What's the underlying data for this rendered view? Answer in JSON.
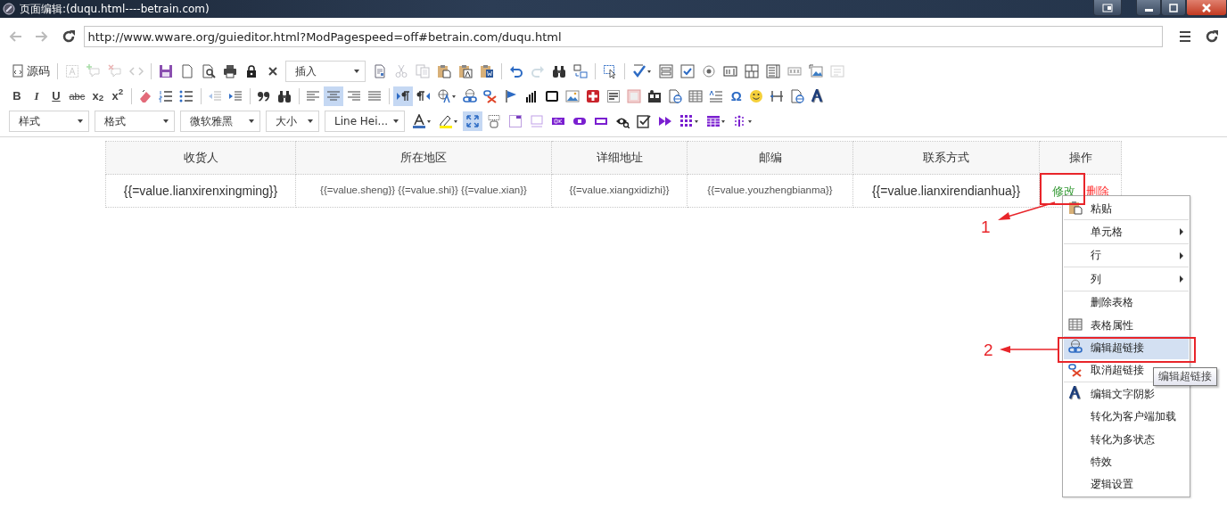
{
  "window": {
    "title": "页面编辑:(duqu.html----betrain.com)"
  },
  "browser": {
    "nav": [
      {
        "kind": "back",
        "disabled": true
      },
      {
        "kind": "forward",
        "disabled": true
      },
      {
        "kind": "reload",
        "disabled": false
      }
    ],
    "url": "http://www.wware.org/guieditor.html?ModPagespeed=off#betrain.com/duqu.html"
  },
  "toolbar_rows": [
    [
      {
        "kind": "text-button",
        "label": "源码"
      },
      {
        "kind": "separator"
      },
      {
        "kind": "icon",
        "disabled": true
      },
      {
        "kind": "icon",
        "disabled": true
      },
      {
        "kind": "icon",
        "disabled": true
      },
      {
        "kind": "icon",
        "disabled": true
      },
      {
        "kind": "separator"
      },
      {
        "kind": "icon",
        "disabled": false
      },
      {
        "kind": "icon",
        "disabled": false
      },
      {
        "kind": "icon",
        "disabled": false
      },
      {
        "kind": "icon",
        "disabled": false
      },
      {
        "kind": "icon",
        "disabled": false
      },
      {
        "kind": "icon",
        "disabled": false
      },
      {
        "kind": "select",
        "value": "插入"
      },
      {
        "kind": "icon",
        "disabled": false
      },
      {
        "kind": "icon",
        "disabled": true
      },
      {
        "kind": "icon",
        "disabled": true
      },
      {
        "kind": "icon",
        "disabled": false
      },
      {
        "kind": "icon",
        "disabled": false
      },
      {
        "kind": "icon",
        "disabled": false
      },
      {
        "kind": "separator"
      },
      {
        "kind": "icon",
        "disabled": false
      },
      {
        "kind": "icon",
        "disabled": true
      },
      {
        "kind": "icon",
        "disabled": false
      },
      {
        "kind": "icon",
        "disabled": false
      },
      {
        "kind": "separator"
      },
      {
        "kind": "icon",
        "disabled": false
      },
      {
        "kind": "separator"
      },
      {
        "kind": "icon",
        "disabled": false
      },
      {
        "kind": "icon",
        "disabled": false
      },
      {
        "kind": "icon",
        "disabled": false
      },
      {
        "kind": "icon",
        "disabled": false
      },
      {
        "kind": "icon",
        "disabled": false
      },
      {
        "kind": "icon",
        "disabled": false
      },
      {
        "kind": "icon",
        "disabled": false
      },
      {
        "kind": "icon",
        "disabled": false
      },
      {
        "kind": "icon",
        "disabled": false
      },
      {
        "kind": "icon",
        "disabled": true
      }
    ],
    [
      {
        "kind": "glyph",
        "text": "B",
        "selected": false
      },
      {
        "kind": "glyph",
        "text": "I",
        "selected": false
      },
      {
        "kind": "glyph",
        "text": "U",
        "selected": false
      },
      {
        "kind": "glyph",
        "text": "abc",
        "selected": false
      },
      {
        "kind": "glyph",
        "text": "x$_{2}$",
        "selected": false
      },
      {
        "kind": "glyph",
        "text": "x$^{2}$",
        "selected": false
      },
      {
        "kind": "separator"
      },
      {
        "kind": "icon",
        "disabled": false
      },
      {
        "kind": "icon",
        "disabled": false
      },
      {
        "kind": "icon",
        "disabled": false
      },
      {
        "kind": "separator"
      },
      {
        "kind": "icon",
        "disabled": true
      },
      {
        "kind": "icon",
        "disabled": false
      },
      {
        "kind": "separator"
      },
      {
        "kind": "icon",
        "disabled": false
      },
      {
        "kind": "icon",
        "disabled": false
      },
      {
        "kind": "separator"
      },
      {
        "kind": "icon",
        "disabled": false,
        "selected": false
      },
      {
        "kind": "icon",
        "disabled": false,
        "selected": true
      },
      {
        "kind": "icon",
        "disabled": false,
        "selected": false
      },
      {
        "kind": "icon",
        "disabled": false,
        "selected": false
      },
      {
        "kind": "separator"
      },
      {
        "kind": "icon",
        "disabled": false,
        "selected": true
      },
      {
        "kind": "icon",
        "disabled": false,
        "selected": false
      },
      {
        "kind": "icon",
        "disabled": false
      },
      {
        "kind": "icon",
        "disabled": false
      },
      {
        "kind": "icon",
        "disabled": false
      },
      {
        "kind": "icon",
        "disabled": false
      },
      {
        "kind": "icon",
        "disabled": false
      },
      {
        "kind": "icon",
        "disabled": false
      },
      {
        "kind": "icon",
        "disabled": false
      },
      {
        "kind": "icon",
        "disabled": false
      },
      {
        "kind": "icon",
        "disabled": false
      },
      {
        "kind": "icon",
        "disabled": false
      },
      {
        "kind": "icon",
        "disabled": false
      },
      {
        "kind": "icon",
        "disabled": false
      },
      {
        "kind": "icon",
        "disabled": false
      },
      {
        "kind": "icon",
        "disabled": false
      },
      {
        "kind": "glyph",
        "text": "Ω"
      },
      {
        "kind": "icon",
        "disabled": false
      },
      {
        "kind": "icon",
        "disabled": false
      },
      {
        "kind": "icon",
        "disabled": false
      },
      {
        "kind": "icon",
        "disabled": false
      }
    ],
    [
      {
        "kind": "select",
        "value": "样式"
      },
      {
        "kind": "select",
        "value": "格式"
      },
      {
        "kind": "select",
        "value": "微软雅黑"
      },
      {
        "kind": "select",
        "value": "大小"
      },
      {
        "kind": "select",
        "value": "Line Hei..."
      },
      {
        "kind": "icon",
        "disabled": false
      },
      {
        "kind": "icon",
        "disabled": false
      },
      {
        "kind": "icon",
        "disabled": false,
        "selected": true
      },
      {
        "kind": "icon",
        "disabled": false,
        "selected": false
      },
      {
        "kind": "icon",
        "disabled": false
      },
      {
        "kind": "icon",
        "disabled": false
      },
      {
        "kind": "icon",
        "disabled": false
      },
      {
        "kind": "icon",
        "disabled": false
      },
      {
        "kind": "icon",
        "disabled": false
      },
      {
        "kind": "icon",
        "disabled": false
      },
      {
        "kind": "icon",
        "disabled": false
      },
      {
        "kind": "icon",
        "disabled": false
      },
      {
        "kind": "icon",
        "disabled": false
      },
      {
        "kind": "icon",
        "disabled": false
      },
      {
        "kind": "icon",
        "disabled": false
      }
    ]
  ],
  "table": {
    "columns": [
      "收货人",
      "所在地区",
      "详细地址",
      "邮编",
      "联系方式",
      "操作"
    ],
    "rows": [
      {
        "cells": [
          "{{=value.lianxirenxingming}}",
          "{{=value.sheng}} {{=value.shi}} {{=value.xian}}",
          "{{=value.xiangxidizhi}}",
          "{{=value.youzhengbianma}}",
          "{{=value.lianxirendianhua}}"
        ],
        "actions": [
          {
            "label": "修改",
            "color": "#339933"
          },
          {
            "label": "删除",
            "color": "#ff3333"
          }
        ]
      }
    ]
  },
  "context_menu": {
    "items": [
      {
        "kind": "item",
        "label": "粘贴",
        "selected": false
      },
      {
        "kind": "separator"
      },
      {
        "kind": "submenu",
        "label": "单元格",
        "selected": false
      },
      {
        "kind": "separator"
      },
      {
        "kind": "submenu",
        "label": "行",
        "selected": false
      },
      {
        "kind": "separator"
      },
      {
        "kind": "submenu",
        "label": "列",
        "selected": false
      },
      {
        "kind": "separator"
      },
      {
        "kind": "item",
        "label": "删除表格",
        "selected": false
      },
      {
        "kind": "item",
        "label": "表格属性",
        "selected": false
      },
      {
        "kind": "item",
        "label": "编辑超链接",
        "selected": true
      },
      {
        "kind": "item",
        "label": "取消超链接",
        "selected": false
      },
      {
        "kind": "separator"
      },
      {
        "kind": "item",
        "label": "编辑文字阴影",
        "selected": false
      },
      {
        "kind": "item",
        "label": "转化为客户端加载",
        "selected": false
      },
      {
        "kind": "item",
        "label": "转化为多状态",
        "selected": false
      },
      {
        "kind": "item",
        "label": "特效",
        "selected": false
      },
      {
        "kind": "item",
        "label": "逻辑设置",
        "selected": false
      }
    ]
  },
  "tooltip": "编辑超链接",
  "annotations": [
    {
      "label": "1"
    },
    {
      "label": "2"
    }
  ]
}
